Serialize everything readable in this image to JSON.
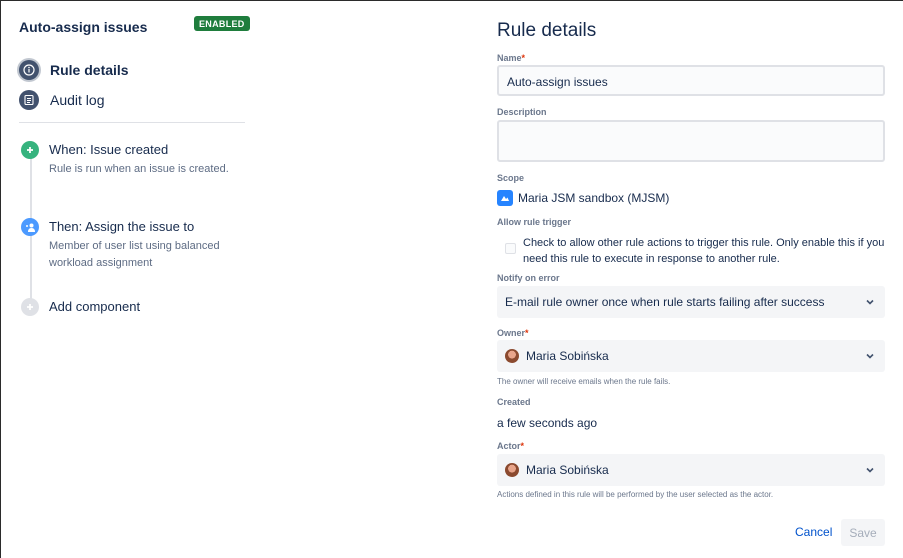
{
  "left": {
    "title": "Auto-assign issues",
    "badge": "ENABLED",
    "nav": [
      {
        "label": "Rule details",
        "icon": "info-icon"
      },
      {
        "label": "Audit log",
        "icon": "list-icon"
      }
    ],
    "components": [
      {
        "title": "When: Issue created",
        "desc": "Rule is run when an issue is created.",
        "icon": "plus-icon",
        "color": "#36b37e"
      },
      {
        "title": "Then: Assign the issue to",
        "desc": "Member of user list using balanced workload assignment",
        "icon": "assign-user-icon",
        "color": "#4c9aff"
      },
      {
        "title": "Add component",
        "icon": "plus-icon",
        "color": "#dfe1e6"
      }
    ]
  },
  "form": {
    "title": "Rule details",
    "name_label": "Name",
    "name_value": "Auto-assign issues",
    "description_label": "Description",
    "description_value": "",
    "scope_label": "Scope",
    "scope_value": "Maria JSM sandbox (MJSM)",
    "allow_label": "Allow rule trigger",
    "allow_text": "Check to allow other rule actions to trigger this rule. Only enable this if you need this rule to execute in response to another rule.",
    "notify_label": "Notify on error",
    "notify_value": "E-mail rule owner once when rule starts failing after success",
    "owner_label": "Owner",
    "owner_value": "Maria Sobińska",
    "owner_help": "The owner will receive emails when the rule fails.",
    "created_label": "Created",
    "created_value": "a few seconds ago",
    "actor_label": "Actor",
    "actor_value": "Maria Sobińska",
    "actor_help": "Actions defined in this rule will be performed by the user selected as the actor.",
    "required_mark": "*",
    "cancel": "Cancel",
    "save": "Save"
  },
  "colors": {
    "badge": "#1f7d3d",
    "link": "#0052cc",
    "required": "#de350b"
  }
}
